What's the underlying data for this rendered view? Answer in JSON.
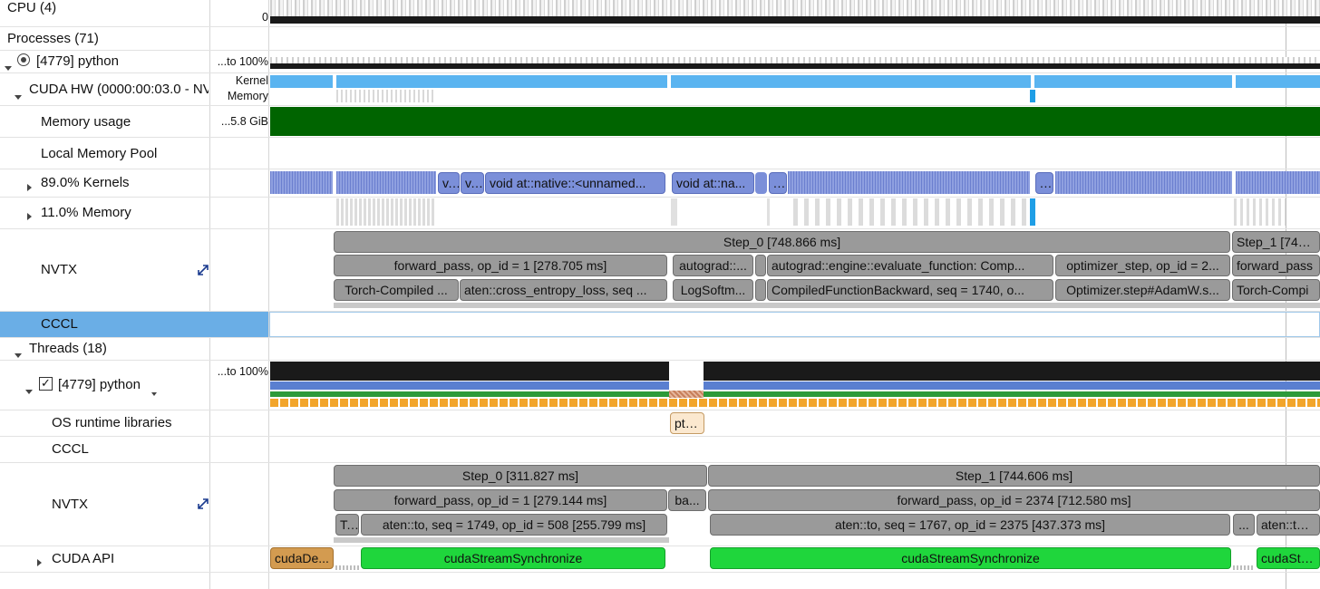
{
  "tree": {
    "cpu": "CPU (4)",
    "cpu_scale": "0",
    "processes": "Processes (71)",
    "python_proc": "[4779] python",
    "python_proc_scale": "...to 100%",
    "cuda_hw": "CUDA HW (0000:00:03.0 - NV",
    "cuda_hw_scale_1": "Kernel",
    "cuda_hw_scale_2": "Memory",
    "memory_usage": "Memory usage",
    "memory_usage_scale": "...5.8 GiB",
    "local_memory_pool": "Local Memory Pool",
    "kernels": "89.0% Kernels",
    "memory": "11.0% Memory",
    "nvtx": "NVTX",
    "cccl": "CCCL",
    "threads": "Threads (18)",
    "thread_python": "[4779] python",
    "thread_python_scale": "...to 100%",
    "os_runtime": "OS runtime libraries",
    "cccl2": "CCCL",
    "nvtx2": "NVTX",
    "cuda_api": "CUDA API"
  },
  "kernel_bars": [
    "v...",
    "v...",
    "void at::native::<unnamed...",
    "void at::na...",
    "...",
    "..."
  ],
  "gpu_nvtx": {
    "row1": [
      "Step_0 [748.866 ms]",
      "Step_1 [743.6"
    ],
    "row2": [
      "forward_pass, op_id = 1 [278.705 ms]",
      "autograd::...",
      "autograd::engine::evaluate_function: Comp...",
      "optimizer_step, op_id = 2...",
      "forward_pass"
    ],
    "row3": [
      "Torch-Compiled ...",
      "aten::cross_entropy_loss, seq ...",
      "LogSoftm...",
      "CompiledFunctionBackward, seq = 1740, o...",
      "Optimizer.step#AdamW.s...",
      "Torch-Compi"
    ]
  },
  "os_runtime_bar": "pth...",
  "thread_nvtx": {
    "row1": [
      "Step_0 [311.827 ms]",
      "Step_1 [744.606 ms]"
    ],
    "row2": [
      "forward_pass, op_id = 1 [279.144 ms]",
      "ba...",
      "forward_pass, op_id = 2374 [712.580 ms]"
    ],
    "row3": [
      "T...",
      "aten::to, seq = 1749, op_id = 508 [255.799 ms]",
      "aten::to, seq = 1767, op_id = 2375 [437.373 ms]",
      "...",
      "aten::to, seq"
    ]
  },
  "cuda_api_bars": [
    "cudaDe...",
    "cudaStreamSynchronize",
    "cudaStreamSynchronize",
    "cudaStrea"
  ],
  "colors": {
    "selected_row": "#6aaee6",
    "memory_usage": "#006400",
    "kernel": "#7b8fd9",
    "nvtx": "#9a9a9a",
    "api_green": "#1fd63c",
    "api_orange": "#d39b50",
    "cuda_hw_light": "#5ab4f0",
    "thread_orange": "#f2a52b"
  }
}
